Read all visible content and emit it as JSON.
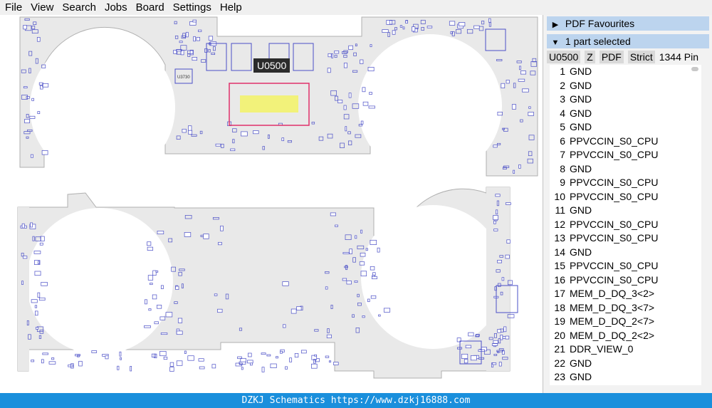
{
  "menu": [
    "File",
    "View",
    "Search",
    "Jobs",
    "Board",
    "Settings",
    "Help"
  ],
  "board": {
    "selected_part_label": "U0500",
    "silkscreen_label": "U3730",
    "board_fill": "#e9e9e9",
    "component_color": "#4a4fc7",
    "highlight_color": "#f2f27a",
    "highlight_border": "#e0306a"
  },
  "panel": {
    "pdf_favourites": "PDF Favourites",
    "parts_selected": "1 part selected",
    "toolbar": {
      "part": "U0500",
      "zoom": "Z",
      "pdf": "PDF",
      "strict": "Strict",
      "pin_count": "1344 Pin"
    },
    "pins": [
      {
        "num": "1",
        "net": "GND"
      },
      {
        "num": "2",
        "net": "GND"
      },
      {
        "num": "3",
        "net": "GND"
      },
      {
        "num": "4",
        "net": "GND"
      },
      {
        "num": "5",
        "net": "GND"
      },
      {
        "num": "6",
        "net": "PPVCCIN_S0_CPU"
      },
      {
        "num": "7",
        "net": "PPVCCIN_S0_CPU"
      },
      {
        "num": "8",
        "net": "GND"
      },
      {
        "num": "9",
        "net": "PPVCCIN_S0_CPU"
      },
      {
        "num": "10",
        "net": "PPVCCIN_S0_CPU"
      },
      {
        "num": "11",
        "net": "GND"
      },
      {
        "num": "12",
        "net": "PPVCCIN_S0_CPU"
      },
      {
        "num": "13",
        "net": "PPVCCIN_S0_CPU"
      },
      {
        "num": "14",
        "net": "GND"
      },
      {
        "num": "15",
        "net": "PPVCCIN_S0_CPU"
      },
      {
        "num": "16",
        "net": "PPVCCIN_S0_CPU"
      },
      {
        "num": "17",
        "net": "MEM_D_DQ_3<2>"
      },
      {
        "num": "18",
        "net": "MEM_D_DQ_3<7>"
      },
      {
        "num": "19",
        "net": "MEM_D_DQ_2<7>"
      },
      {
        "num": "20",
        "net": "MEM_D_DQ_2<2>"
      },
      {
        "num": "21",
        "net": "DDR_VIEW_0"
      },
      {
        "num": "22",
        "net": "GND"
      },
      {
        "num": "23",
        "net": "GND"
      }
    ]
  },
  "banner": "DZKJ Schematics https://www.dzkj16888.com"
}
